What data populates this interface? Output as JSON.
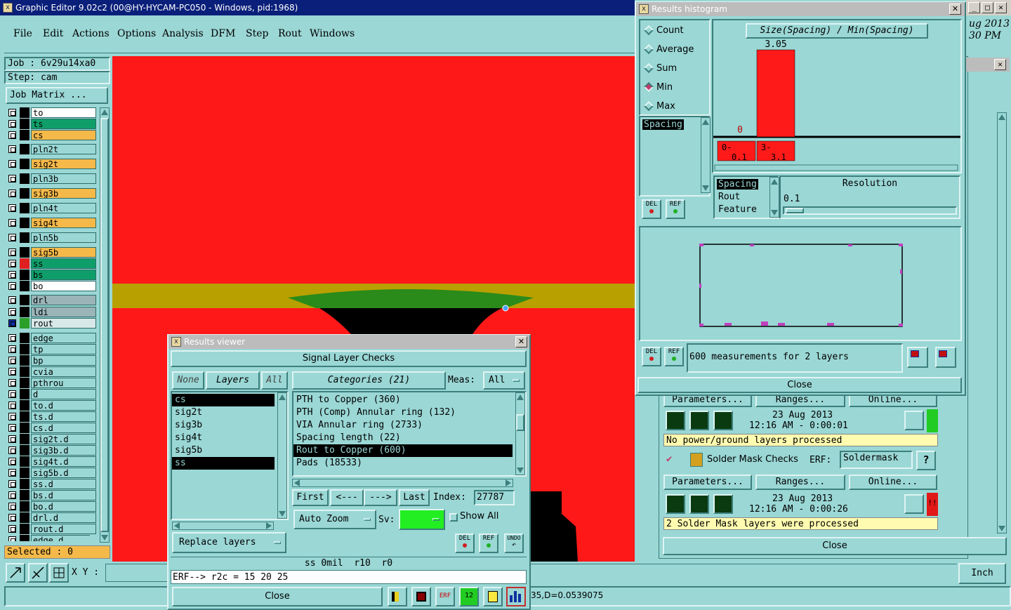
{
  "app": {
    "title": "Graphic Editor 9.02c2 (00@HY-HYCAM-PC050 - Windows, pid:1968)",
    "menu": [
      "File",
      "Edit",
      "Actions",
      "Options",
      "Analysis",
      "DFM",
      "Step",
      "Rout",
      "Windows"
    ],
    "job_label": "Job : 6v29u14xa0",
    "step_label": "Step: cam",
    "job_matrix_button": "Job Matrix ...",
    "selected_label": "Selected : 0",
    "xy_label": "X Y :",
    "units_button": "Inch",
    "status_text": "35,D=0.0539075",
    "clock_date": "ug 2013",
    "clock_time": "30 PM"
  },
  "layers": [
    {
      "name": "to",
      "color": "#ffffff",
      "swatch": "#000000",
      "state": "off"
    },
    {
      "name": "ts",
      "color": "#0f9e6a",
      "swatch": "#000000",
      "state": "off"
    },
    {
      "name": "cs",
      "color": "#f5b94a",
      "swatch": "#000000",
      "state": "off"
    },
    {
      "name": "pln2t",
      "color": "#9ad7d5",
      "swatch": "#000000",
      "state": "off"
    },
    {
      "name": "sig2t",
      "color": "#f5b94a",
      "swatch": "#000000",
      "state": "off"
    },
    {
      "name": "pln3b",
      "color": "#9ad7d5",
      "swatch": "#000000",
      "state": "off"
    },
    {
      "name": "sig3b",
      "color": "#f5b94a",
      "swatch": "#000000",
      "state": "off"
    },
    {
      "name": "pln4t",
      "color": "#9ad7d5",
      "swatch": "#000000",
      "state": "off"
    },
    {
      "name": "sig4t",
      "color": "#f5b94a",
      "swatch": "#000000",
      "state": "off"
    },
    {
      "name": "pln5b",
      "color": "#9ad7d5",
      "swatch": "#000000",
      "state": "off"
    },
    {
      "name": "sig5b",
      "color": "#f5b94a",
      "swatch": "#000000",
      "state": "off"
    },
    {
      "name": "ss",
      "color": "#0f9e6a",
      "swatch": "#e02020",
      "state": "off"
    },
    {
      "name": "bs",
      "color": "#0f9e6a",
      "swatch": "#000000",
      "state": "off"
    },
    {
      "name": "bo",
      "color": "#ffffff",
      "swatch": "#000000",
      "state": "off"
    },
    {
      "name": "drl",
      "color": "#9ab4b8",
      "swatch": "#000000",
      "state": "off"
    },
    {
      "name": "ldi",
      "color": "#9ab4b8",
      "swatch": "#000000",
      "state": "off"
    },
    {
      "name": "rout",
      "color": "#d8e8e8",
      "swatch": "#2aa02a",
      "state": "on"
    },
    {
      "name": "edge",
      "color": "#9ad7d5",
      "swatch": "#000000",
      "state": "off"
    },
    {
      "name": "tp",
      "color": "#9ad7d5",
      "swatch": "#000000",
      "state": "off"
    },
    {
      "name": "bp",
      "color": "#9ad7d5",
      "swatch": "#000000",
      "state": "off"
    },
    {
      "name": "cvia",
      "color": "#9ad7d5",
      "swatch": "#000000",
      "state": "off"
    },
    {
      "name": "pthrou",
      "color": "#9ad7d5",
      "swatch": "#000000",
      "state": "off"
    },
    {
      "name": "d",
      "color": "#9ad7d5",
      "swatch": "#000000",
      "state": "off"
    },
    {
      "name": "to.d",
      "color": "#9ad7d5",
      "swatch": "#000000",
      "state": "off"
    },
    {
      "name": "ts.d",
      "color": "#9ad7d5",
      "swatch": "#000000",
      "state": "off"
    },
    {
      "name": "cs.d",
      "color": "#9ad7d5",
      "swatch": "#000000",
      "state": "off"
    },
    {
      "name": "sig2t.d",
      "color": "#9ad7d5",
      "swatch": "#000000",
      "state": "off"
    },
    {
      "name": "sig3b.d",
      "color": "#9ad7d5",
      "swatch": "#000000",
      "state": "off"
    },
    {
      "name": "sig4t.d",
      "color": "#9ad7d5",
      "swatch": "#000000",
      "state": "off"
    },
    {
      "name": "sig5b.d",
      "color": "#9ad7d5",
      "swatch": "#000000",
      "state": "off"
    },
    {
      "name": "ss.d",
      "color": "#9ad7d5",
      "swatch": "#000000",
      "state": "off"
    },
    {
      "name": "bs.d",
      "color": "#9ad7d5",
      "swatch": "#000000",
      "state": "off"
    },
    {
      "name": "bo.d",
      "color": "#9ad7d5",
      "swatch": "#000000",
      "state": "off"
    },
    {
      "name": "drl.d",
      "color": "#9ad7d5",
      "swatch": "#000000",
      "state": "off"
    },
    {
      "name": "rout.d",
      "color": "#9ad7d5",
      "swatch": "#000000",
      "state": "off"
    },
    {
      "name": "edge.d",
      "color": "#9ad7d5",
      "swatch": "#000000",
      "state": "off"
    }
  ],
  "results_viewer": {
    "title": "Results viewer",
    "header": "Signal Layer Checks",
    "none_button": "None",
    "layers_button": "Layers",
    "all_button": "All",
    "categories_button": "Categories (21)",
    "meas_label": "Meas:",
    "meas_value": "All",
    "layer_list": [
      {
        "name": "cs",
        "selected": true
      },
      {
        "name": "sig2t",
        "selected": false
      },
      {
        "name": "sig3b",
        "selected": false
      },
      {
        "name": "sig4t",
        "selected": false
      },
      {
        "name": "sig5b",
        "selected": false
      },
      {
        "name": "ss",
        "selected": true
      }
    ],
    "categories": [
      {
        "label": "PTH to Copper (360)",
        "selected": false
      },
      {
        "label": "PTH (Comp) Annular ring (132)",
        "selected": false
      },
      {
        "label": "VIA Annular ring (2733)",
        "selected": false
      },
      {
        "label": "Spacing length (22)",
        "selected": false
      },
      {
        "label": "Rout to Copper (600)",
        "selected": true
      },
      {
        "label": "Pads (18533)",
        "selected": false
      }
    ],
    "first_button": "First",
    "prev_button": "<---",
    "next_button": "--->",
    "last_button": "Last",
    "index_label": "Index:",
    "index_value": "27787",
    "auto_zoom_button": "Auto Zoom",
    "sv_label": "Sv:",
    "show_all_label": "Show All",
    "replace_layers_button": "Replace layers",
    "del_label": "DEL",
    "ref_label": "REF",
    "undo_label": "UNDO",
    "info_line": "ss 0mil  r10  r0",
    "erf_line": "ERF--> r2c = 15 20 25",
    "close_button": "Close"
  },
  "histogram": {
    "title": "Results histogram",
    "modes": [
      {
        "label": "Count",
        "selected": false
      },
      {
        "label": "Average",
        "selected": false
      },
      {
        "label": "Sum",
        "selected": false
      },
      {
        "label": "Min",
        "selected": true
      },
      {
        "label": "Max",
        "selected": false
      }
    ],
    "type_list": [
      "Spacing"
    ],
    "measure_list": [
      "Spacing",
      "Rout",
      "Feature"
    ],
    "resolution_label": "Resolution",
    "resolution_value": "0.1",
    "measurements_text": "600 measurements for 2 layers",
    "del_label": "DEL",
    "ref_label": "REF",
    "close_button": "Close"
  },
  "chart_data": {
    "type": "bar",
    "title": "Size(Spacing) / Min(Spacing)",
    "categories": [
      "0-\n0.1",
      "3-\n3.1"
    ],
    "category_low": [
      "0-",
      "3-"
    ],
    "category_high": [
      "0.1",
      "3.1"
    ],
    "values": [
      0,
      3.05
    ],
    "value_labels": [
      "0",
      "3.05"
    ],
    "bar_color": "#ff1a1a",
    "ylim": [
      0,
      3.05
    ]
  },
  "analysis": {
    "parameters_button": "Parameters...",
    "ranges_button": "Ranges...",
    "online_button": "Online...",
    "row1_date": "23 Aug 2013",
    "row1_time": "12:16 AM - 0:00:01",
    "row1_message": "No power/ground layers processed",
    "solder_mask_label": "Solder Mask Checks",
    "erf_label": "ERF:",
    "erf_value": "Soldermask",
    "help_label": "?",
    "row2_date": "23 Aug 2013",
    "row2_time": "12:16 AM - 0:00:26",
    "row2_message": "2 Solder Mask layers were processed",
    "status_error_label": "!!",
    "close_button": "Close"
  },
  "colors": {
    "panel": "#9ad7d5",
    "canvas_red": "#ff1818",
    "canvas_olive": "#b8a000",
    "title_active": "#0a1f7a",
    "title_inactive": "#bcbcbc",
    "highlight_black": "#000000",
    "yellow_message": "#fffbb0",
    "green_status": "#22cc22"
  }
}
